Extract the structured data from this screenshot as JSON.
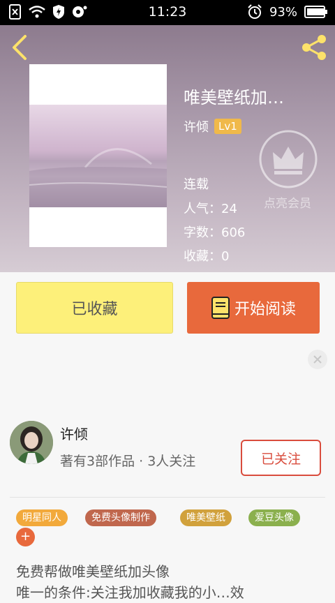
{
  "status_bar": {
    "time": "11:23",
    "battery": "93%"
  },
  "book": {
    "title": "唯美壁纸加…",
    "author": "许倾",
    "level": "Lv1",
    "status": "连载",
    "popularity_label": "人气：",
    "popularity": "24",
    "words_label": "字数：",
    "words": "606",
    "favorites_label": "收藏：",
    "favorites": "0"
  },
  "member": {
    "label": "点亮会员"
  },
  "actions": {
    "favorited_label": "已收藏",
    "read_label": "开始阅读"
  },
  "writer": {
    "name": "许倾",
    "info": "著有3部作品 · 3人关注",
    "follow_label": "已关注"
  },
  "tags": [
    {
      "label": "明星同人",
      "color": "#f2a93b"
    },
    {
      "label": "免费头像制作",
      "color": "#c0674d"
    },
    {
      "label": "唯美壁纸",
      "color": "#d1a13c"
    },
    {
      "label": "爱豆头像",
      "color": "#8bb04e"
    }
  ],
  "tag_add_label": "+",
  "description": {
    "line1": "免费帮做唯美壁纸加头像",
    "line2": "唯一的条件:关注我加收藏我的小…效"
  }
}
